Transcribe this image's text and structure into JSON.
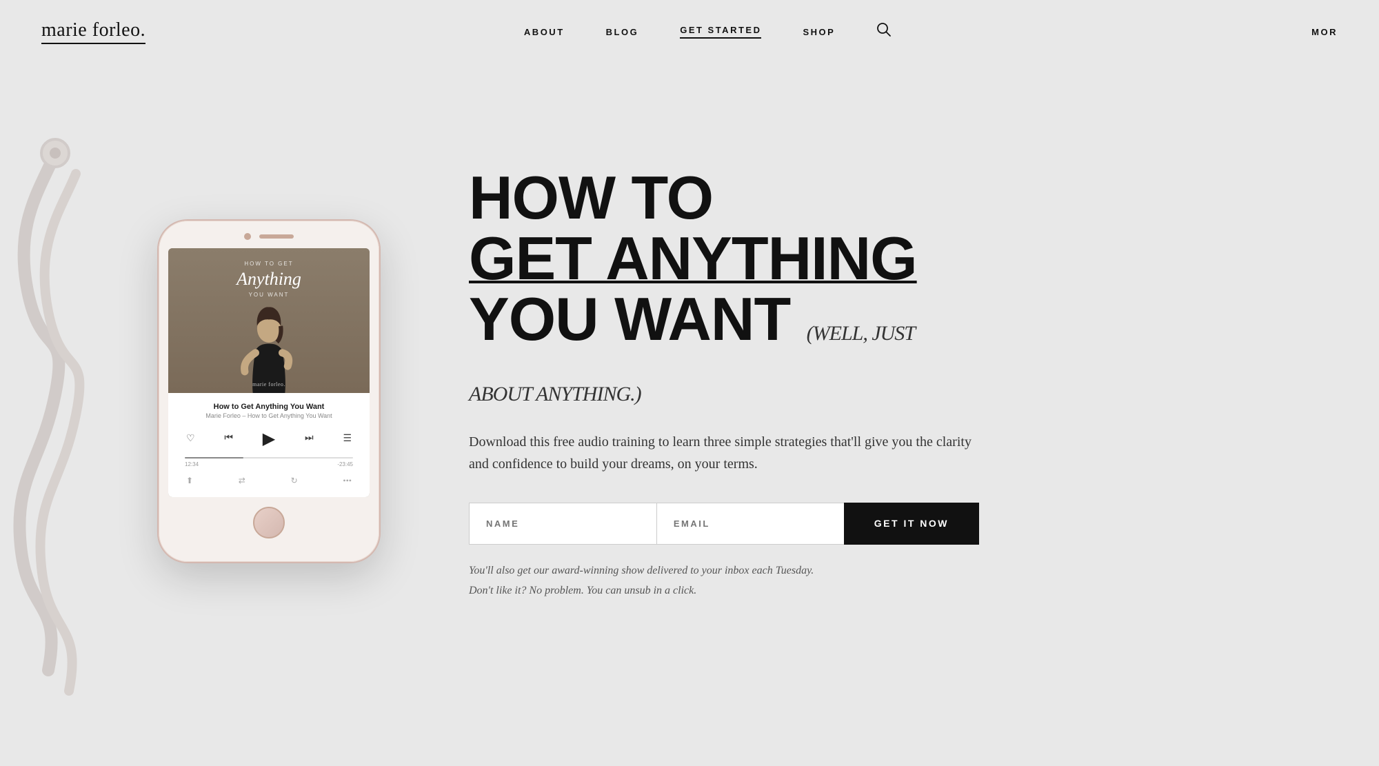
{
  "header": {
    "logo": "marie forleo.",
    "nav": {
      "items": [
        {
          "label": "ABOUT",
          "active": false
        },
        {
          "label": "BLOG",
          "active": false
        },
        {
          "label": "GET STARTED",
          "active": true
        },
        {
          "label": "SHOP",
          "active": false
        }
      ],
      "more_label": "MOR"
    }
  },
  "hero": {
    "headline_line1": "HOW TO",
    "headline_line2": "GET ANYTHING",
    "headline_line3": "YOU WANT",
    "headline_sub": "(Well, just about anything.)",
    "description": "Download this free audio training to learn three simple strategies that'll give you the clarity and confidence to build your dreams, on your terms.",
    "form": {
      "name_placeholder": "NAME",
      "email_placeholder": "EMAIL",
      "submit_label": "GET IT NOW"
    },
    "fine_print_line1": "You'll also get our award-winning show delivered to your inbox each Tuesday.",
    "fine_print_line2": "Don't like it? No problem. You can unsub in a click."
  },
  "phone": {
    "cover_top_text": "HOW TO GET",
    "cover_title": "Anything",
    "cover_subtitle": "YOU WANT",
    "brand_label": "marie forleo.",
    "track_title": "How to Get Anything You Want",
    "track_subtitle": "Marie Forleo – How to Get Anything You Want"
  }
}
